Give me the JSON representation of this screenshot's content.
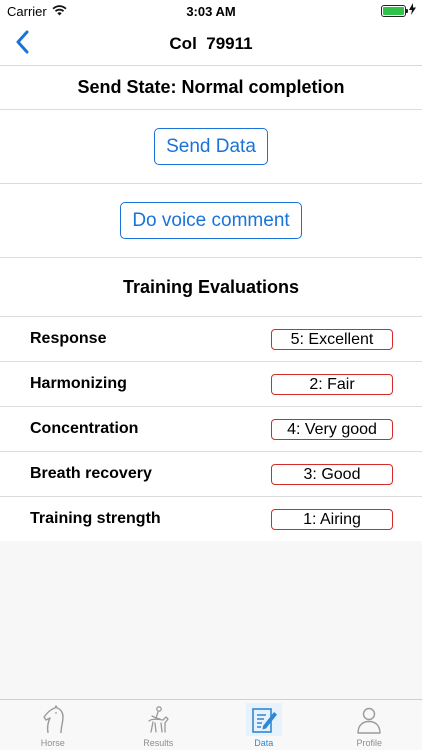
{
  "status_bar": {
    "carrier": "Carrier",
    "time": "3:03 AM",
    "battery_level": 1.0,
    "icons": [
      "wifi-icon",
      "battery-icon",
      "charging-bolt-icon"
    ]
  },
  "nav": {
    "title": "Col  79911",
    "back_icon": "chevron-left-icon"
  },
  "send_state": "Send State: Normal completion",
  "buttons": {
    "send_data": "Send Data",
    "voice_comment": "Do voice comment"
  },
  "evaluations": {
    "title": "Training Evaluations",
    "items": [
      {
        "label": "Response",
        "value": "5: Excellent"
      },
      {
        "label": "Harmonizing",
        "value": "2: Fair"
      },
      {
        "label": "Concentration",
        "value": "4: Very good"
      },
      {
        "label": "Breath recovery",
        "value": "3: Good"
      },
      {
        "label": "Training strength",
        "value": "1: Airing"
      }
    ]
  },
  "tabs": [
    {
      "label": "Horse",
      "icon": "horse-head-icon",
      "active": false
    },
    {
      "label": "Results",
      "icon": "rider-icon",
      "active": false
    },
    {
      "label": "Data",
      "icon": "edit-document-icon",
      "active": true
    },
    {
      "label": "Profile",
      "icon": "person-icon",
      "active": false
    }
  ],
  "colors": {
    "accent": "#1a73d9",
    "eval_border": "#d42a2a",
    "tab_active": "#2f88d5",
    "battery": "#2fc34a"
  }
}
